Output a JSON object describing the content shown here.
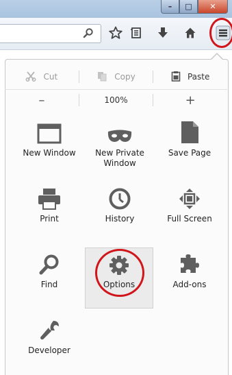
{
  "window": {
    "minimize_glyph": "–",
    "maximize_glyph": "□",
    "close_glyph": "✕"
  },
  "toolbar": {
    "icons": [
      "search-icon",
      "bookmark-star-icon",
      "reading-list-icon",
      "download-icon",
      "home-icon",
      "hamburger-menu-icon"
    ]
  },
  "menu": {
    "edit": {
      "cut": "Cut",
      "copy": "Copy",
      "paste": "Paste"
    },
    "zoom": {
      "out": "–",
      "level": "100%",
      "in": "+"
    },
    "items": [
      {
        "label": "New Window",
        "icon": "new-window-icon"
      },
      {
        "label": "New Private Window",
        "icon": "private-mask-icon"
      },
      {
        "label": "Save Page",
        "icon": "save-page-icon"
      },
      {
        "label": "Print",
        "icon": "printer-icon"
      },
      {
        "label": "History",
        "icon": "history-clock-icon"
      },
      {
        "label": "Full Screen",
        "icon": "fullscreen-icon"
      },
      {
        "label": "Find",
        "icon": "find-magnifier-icon"
      },
      {
        "label": "Options",
        "icon": "options-gear-icon"
      },
      {
        "label": "Add-ons",
        "icon": "addons-puzzle-icon"
      },
      {
        "label": "Developer",
        "icon": "developer-wrench-icon"
      }
    ]
  },
  "colors": {
    "annotation_red": "#d0151b",
    "icon_gray": "#5f5f5f",
    "hover_bg": "#ebebeb"
  }
}
